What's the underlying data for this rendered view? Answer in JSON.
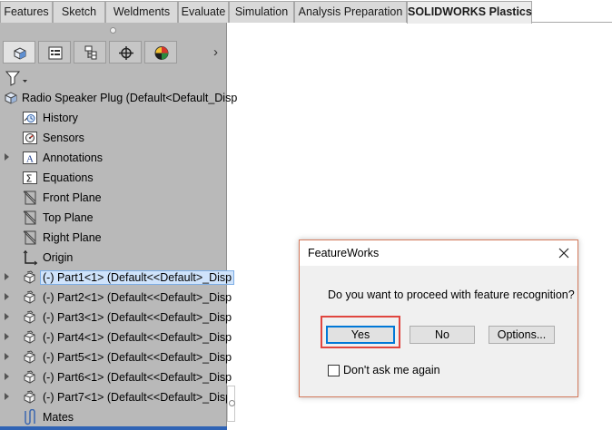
{
  "tabs": [
    {
      "label": "Features",
      "active": false
    },
    {
      "label": "Sketch",
      "active": false
    },
    {
      "label": "Weldments",
      "active": false
    },
    {
      "label": "Evaluate",
      "active": false
    },
    {
      "label": "Simulation",
      "active": false
    },
    {
      "label": "Analysis Preparation",
      "active": false
    },
    {
      "label": "SOLIDWORKS Plastics",
      "active": true
    }
  ],
  "feature_manager": {
    "icon_tabs": [
      {
        "name": "feature-manager-tree-icon"
      },
      {
        "name": "property-manager-icon"
      },
      {
        "name": "configuration-manager-icon"
      },
      {
        "name": "dimxpert-manager-icon"
      },
      {
        "name": "display-manager-icon"
      }
    ],
    "filter_icon": "filter-icon",
    "tree": [
      {
        "label": "Radio Speaker Plug  (Default<Default_Disp",
        "icon": "assembly-icon",
        "expander": false,
        "level": 0
      },
      {
        "label": "History",
        "icon": "history-folder-icon",
        "expander": false,
        "level": 1
      },
      {
        "label": "Sensors",
        "icon": "sensors-icon",
        "expander": false,
        "level": 1
      },
      {
        "label": "Annotations",
        "icon": "annotations-icon",
        "expander": true,
        "level": 1
      },
      {
        "label": "Equations",
        "icon": "equations-icon",
        "expander": false,
        "level": 1
      },
      {
        "label": "Front Plane",
        "icon": "plane-icon",
        "expander": false,
        "level": 1
      },
      {
        "label": "Top Plane",
        "icon": "plane-icon",
        "expander": false,
        "level": 1
      },
      {
        "label": "Right Plane",
        "icon": "plane-icon",
        "expander": false,
        "level": 1
      },
      {
        "label": "Origin",
        "icon": "origin-icon",
        "expander": false,
        "level": 1
      },
      {
        "label": "(-) Part1<1> (Default<<Default>_Disp",
        "icon": "part-icon",
        "expander": true,
        "level": 1,
        "selected": true
      },
      {
        "label": "(-) Part2<1> (Default<<Default>_Disp",
        "icon": "part-icon",
        "expander": true,
        "level": 1
      },
      {
        "label": "(-) Part3<1> (Default<<Default>_Disp",
        "icon": "part-icon",
        "expander": true,
        "level": 1
      },
      {
        "label": "(-) Part4<1> (Default<<Default>_Disp",
        "icon": "part-icon",
        "expander": true,
        "level": 1
      },
      {
        "label": "(-) Part5<1> (Default<<Default>_Disp",
        "icon": "part-icon",
        "expander": true,
        "level": 1
      },
      {
        "label": "(-) Part6<1> (Default<<Default>_Disp",
        "icon": "part-icon",
        "expander": true,
        "level": 1
      },
      {
        "label": "(-) Part7<1> (Default<<Default>_Disp",
        "icon": "part-icon",
        "expander": true,
        "level": 1
      },
      {
        "label": "Mates",
        "icon": "mates-icon",
        "expander": false,
        "level": 1
      }
    ]
  },
  "dialog": {
    "title": "FeatureWorks",
    "message": "Do you want to proceed with feature recognition?",
    "buttons": {
      "yes": "Yes",
      "no": "No",
      "options": "Options..."
    },
    "checkbox_label": "Don't ask me again",
    "checkbox_checked": false,
    "highlight_color": "#e0463f"
  }
}
